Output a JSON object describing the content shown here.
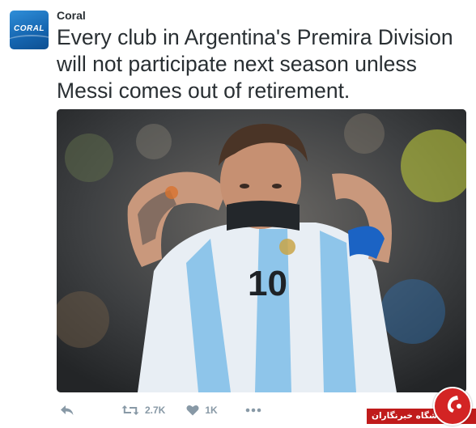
{
  "tweet": {
    "author": "Coral",
    "avatar_label": "CORAL",
    "text": "Every club in Argentina's Premira Division\nwill not participate next season unless\nMessi comes out of retirement.",
    "media": {
      "jersey_number": "10"
    }
  },
  "actions": {
    "reply_icon": "reply-icon",
    "retweet_icon": "retweet-icon",
    "retweet_count": "2.7K",
    "like_icon": "heart-icon",
    "like_count": "1K",
    "more_icon": "more-dots-icon"
  },
  "watermark": {
    "text": "باشگاه خبرنگاران"
  },
  "colors": {
    "text": "#292f33",
    "muted": "#8899a6",
    "avatar_blue": "#1a73c2",
    "watermark_red": "#c01b1b"
  }
}
